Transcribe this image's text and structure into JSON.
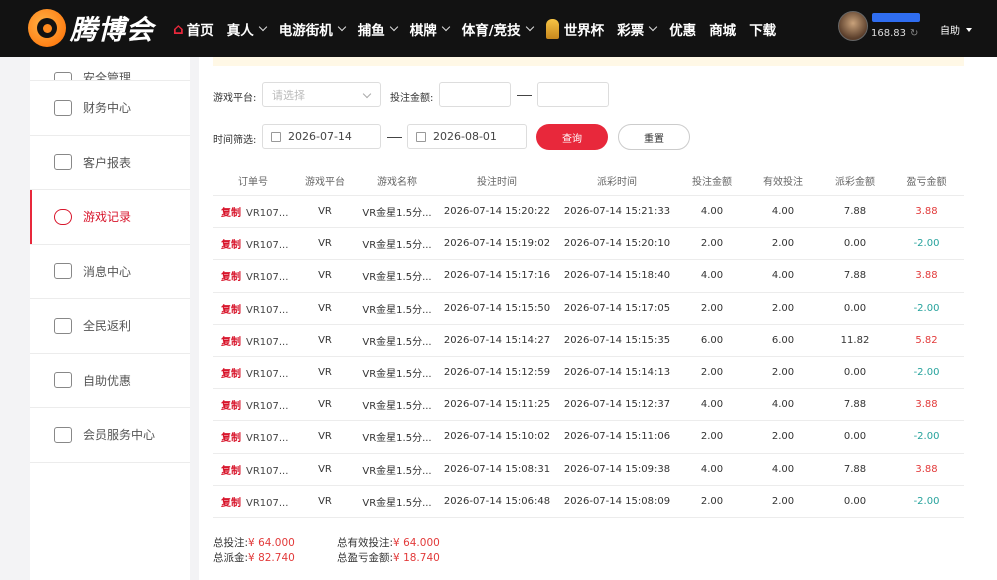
{
  "brand": {
    "name": "腾博会"
  },
  "nav": [
    {
      "label": "首页",
      "home": true,
      "chevron": false
    },
    {
      "label": "真人",
      "chevron": true
    },
    {
      "label": "电游街机",
      "chevron": true
    },
    {
      "label": "捕鱼",
      "chevron": true
    },
    {
      "label": "棋牌",
      "chevron": true
    },
    {
      "label": "体育/竞技",
      "chevron": true
    },
    {
      "label": "世界杯",
      "trophy": true,
      "chevron": false
    },
    {
      "label": "彩票",
      "chevron": true
    },
    {
      "label": "优惠",
      "chevron": false
    },
    {
      "label": "商城",
      "chevron": false
    },
    {
      "label": "下载",
      "chevron": false
    }
  ],
  "user": {
    "balance": "168.83",
    "mode": "自助"
  },
  "sidebar": [
    {
      "label": "安全管理",
      "icon": "shield-icon"
    },
    {
      "label": "财务中心",
      "icon": "wallet-icon"
    },
    {
      "label": "客户报表",
      "icon": "report-icon"
    },
    {
      "label": "游戏记录",
      "icon": "gamepad-icon",
      "active": true
    },
    {
      "label": "消息中心",
      "icon": "mail-icon"
    },
    {
      "label": "全民返利",
      "icon": "rebate-icon"
    },
    {
      "label": "自助优惠",
      "icon": "gift-icon"
    },
    {
      "label": "会员服务中心",
      "icon": "diamond-icon"
    }
  ],
  "filters": {
    "platform_label": "游戏平台:",
    "platform_placeholder": "请选择",
    "amount_label": "投注金额:",
    "time_label": "时间筛选:",
    "date_start": "2026-07-14",
    "date_end": "2026-08-01",
    "query": "查询",
    "reset": "重置"
  },
  "table": {
    "headers": [
      "订单号",
      "游戏平台",
      "游戏名称",
      "投注时间",
      "派彩时间",
      "投注金额",
      "有效投注",
      "派彩金额",
      "盈亏金额"
    ],
    "copy_label": "复制",
    "rows": [
      {
        "order": "VR107...",
        "platform": "VR",
        "game": "VR金星1.5分...",
        "bet_time": "2026-07-14 15:20:22",
        "payout_time": "2026-07-14 15:21:33",
        "bet": "4.00",
        "valid": "4.00",
        "payout": "7.88",
        "pl": "3.88",
        "positive": true
      },
      {
        "order": "VR107...",
        "platform": "VR",
        "game": "VR金星1.5分...",
        "bet_time": "2026-07-14 15:19:02",
        "payout_time": "2026-07-14 15:20:10",
        "bet": "2.00",
        "valid": "2.00",
        "payout": "0.00",
        "pl": "-2.00",
        "positive": false
      },
      {
        "order": "VR107...",
        "platform": "VR",
        "game": "VR金星1.5分...",
        "bet_time": "2026-07-14 15:17:16",
        "payout_time": "2026-07-14 15:18:40",
        "bet": "4.00",
        "valid": "4.00",
        "payout": "7.88",
        "pl": "3.88",
        "positive": true
      },
      {
        "order": "VR107...",
        "platform": "VR",
        "game": "VR金星1.5分...",
        "bet_time": "2026-07-14 15:15:50",
        "payout_time": "2026-07-14 15:17:05",
        "bet": "2.00",
        "valid": "2.00",
        "payout": "0.00",
        "pl": "-2.00",
        "positive": false
      },
      {
        "order": "VR107...",
        "platform": "VR",
        "game": "VR金星1.5分...",
        "bet_time": "2026-07-14 15:14:27",
        "payout_time": "2026-07-14 15:15:35",
        "bet": "6.00",
        "valid": "6.00",
        "payout": "11.82",
        "pl": "5.82",
        "positive": true
      },
      {
        "order": "VR107...",
        "platform": "VR",
        "game": "VR金星1.5分...",
        "bet_time": "2026-07-14 15:12:59",
        "payout_time": "2026-07-14 15:14:13",
        "bet": "2.00",
        "valid": "2.00",
        "payout": "0.00",
        "pl": "-2.00",
        "positive": false
      },
      {
        "order": "VR107...",
        "platform": "VR",
        "game": "VR金星1.5分...",
        "bet_time": "2026-07-14 15:11:25",
        "payout_time": "2026-07-14 15:12:37",
        "bet": "4.00",
        "valid": "4.00",
        "payout": "7.88",
        "pl": "3.88",
        "positive": true
      },
      {
        "order": "VR107...",
        "platform": "VR",
        "game": "VR金星1.5分...",
        "bet_time": "2026-07-14 15:10:02",
        "payout_time": "2026-07-14 15:11:06",
        "bet": "2.00",
        "valid": "2.00",
        "payout": "0.00",
        "pl": "-2.00",
        "positive": false
      },
      {
        "order": "VR107...",
        "platform": "VR",
        "game": "VR金星1.5分...",
        "bet_time": "2026-07-14 15:08:31",
        "payout_time": "2026-07-14 15:09:38",
        "bet": "4.00",
        "valid": "4.00",
        "payout": "7.88",
        "pl": "3.88",
        "positive": true
      },
      {
        "order": "VR107...",
        "platform": "VR",
        "game": "VR金星1.5分...",
        "bet_time": "2026-07-14 15:06:48",
        "payout_time": "2026-07-14 15:08:09",
        "bet": "2.00",
        "valid": "2.00",
        "payout": "0.00",
        "pl": "-2.00",
        "positive": false
      }
    ]
  },
  "totals": {
    "bet_label": "总投注:",
    "bet": "¥ 64.000",
    "valid_label": "总有效投注:",
    "valid": "¥ 64.000",
    "payout_label": "总派金:",
    "payout": "¥ 82.740",
    "pl_label": "总盈亏金额:",
    "pl": "¥ 18.740"
  },
  "colors": {
    "accent": "#e8283b",
    "topbar": "#121212",
    "loss": "#27a39d",
    "profit": "#e23a3a"
  }
}
